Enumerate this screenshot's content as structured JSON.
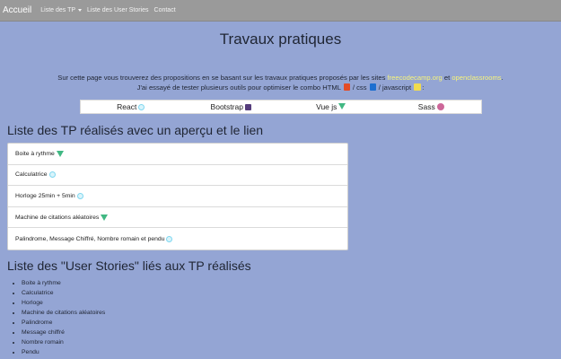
{
  "nav": {
    "brand": "Accueil",
    "links": [
      "Liste des TP",
      "Liste des User Stories",
      "Contact"
    ]
  },
  "title": "Travaux pratiques",
  "intro": {
    "line1_prefix": "Sur cette page vous trouverez des propositions en se basant sur les travaux pratiques proposés par les sites",
    "site1": "freecodecamp.org",
    "and": "et",
    "site2": "openclassrooms",
    "line1_suffix": ".",
    "line2_prefix": "J'ai essayé de tester plusieurs outils pour optimiser le combo HTML",
    "css_text": "/ css",
    "js_text": "/ javascript",
    "line2_suffix": ":"
  },
  "tech": [
    "React",
    "Bootstrap",
    "Vue js",
    "Sass"
  ],
  "tp_section_title": "Liste des TP réalisés avec un aperçu et le lien",
  "tp_items": [
    {
      "label": "Boite à rythme",
      "icon": "vue-icon"
    },
    {
      "label": "Calculatrice",
      "icon": "react-icon"
    },
    {
      "label": "Horloge 25min + 5min",
      "icon": "react-icon"
    },
    {
      "label": "Machine de citations aléatoires",
      "icon": "vue-icon"
    },
    {
      "label": "Palindrome, Message Chiffré, Nombre romain et pendu",
      "icon": "react-icon"
    }
  ],
  "us_section_title": "Liste des \"User Stories\" liés aux TP réalisés",
  "us_items": [
    "Boite à rythme",
    "Calculatrice",
    "Horloge",
    "Machine de citations aléatoires",
    "Palindrome",
    "Message chiffré",
    "Nombre romain",
    "Pendu"
  ],
  "colors": {
    "background": "#94a5d4",
    "navbar": "#9a9a9a",
    "link_highlight": "#f7f47a",
    "vue": "#41b883",
    "react": "#7fd7f0",
    "bootstrap": "#563d7c",
    "sass": "#cd6799",
    "html": "#e34c26",
    "css": "#1e6fd0",
    "js": "#f0db4f"
  }
}
